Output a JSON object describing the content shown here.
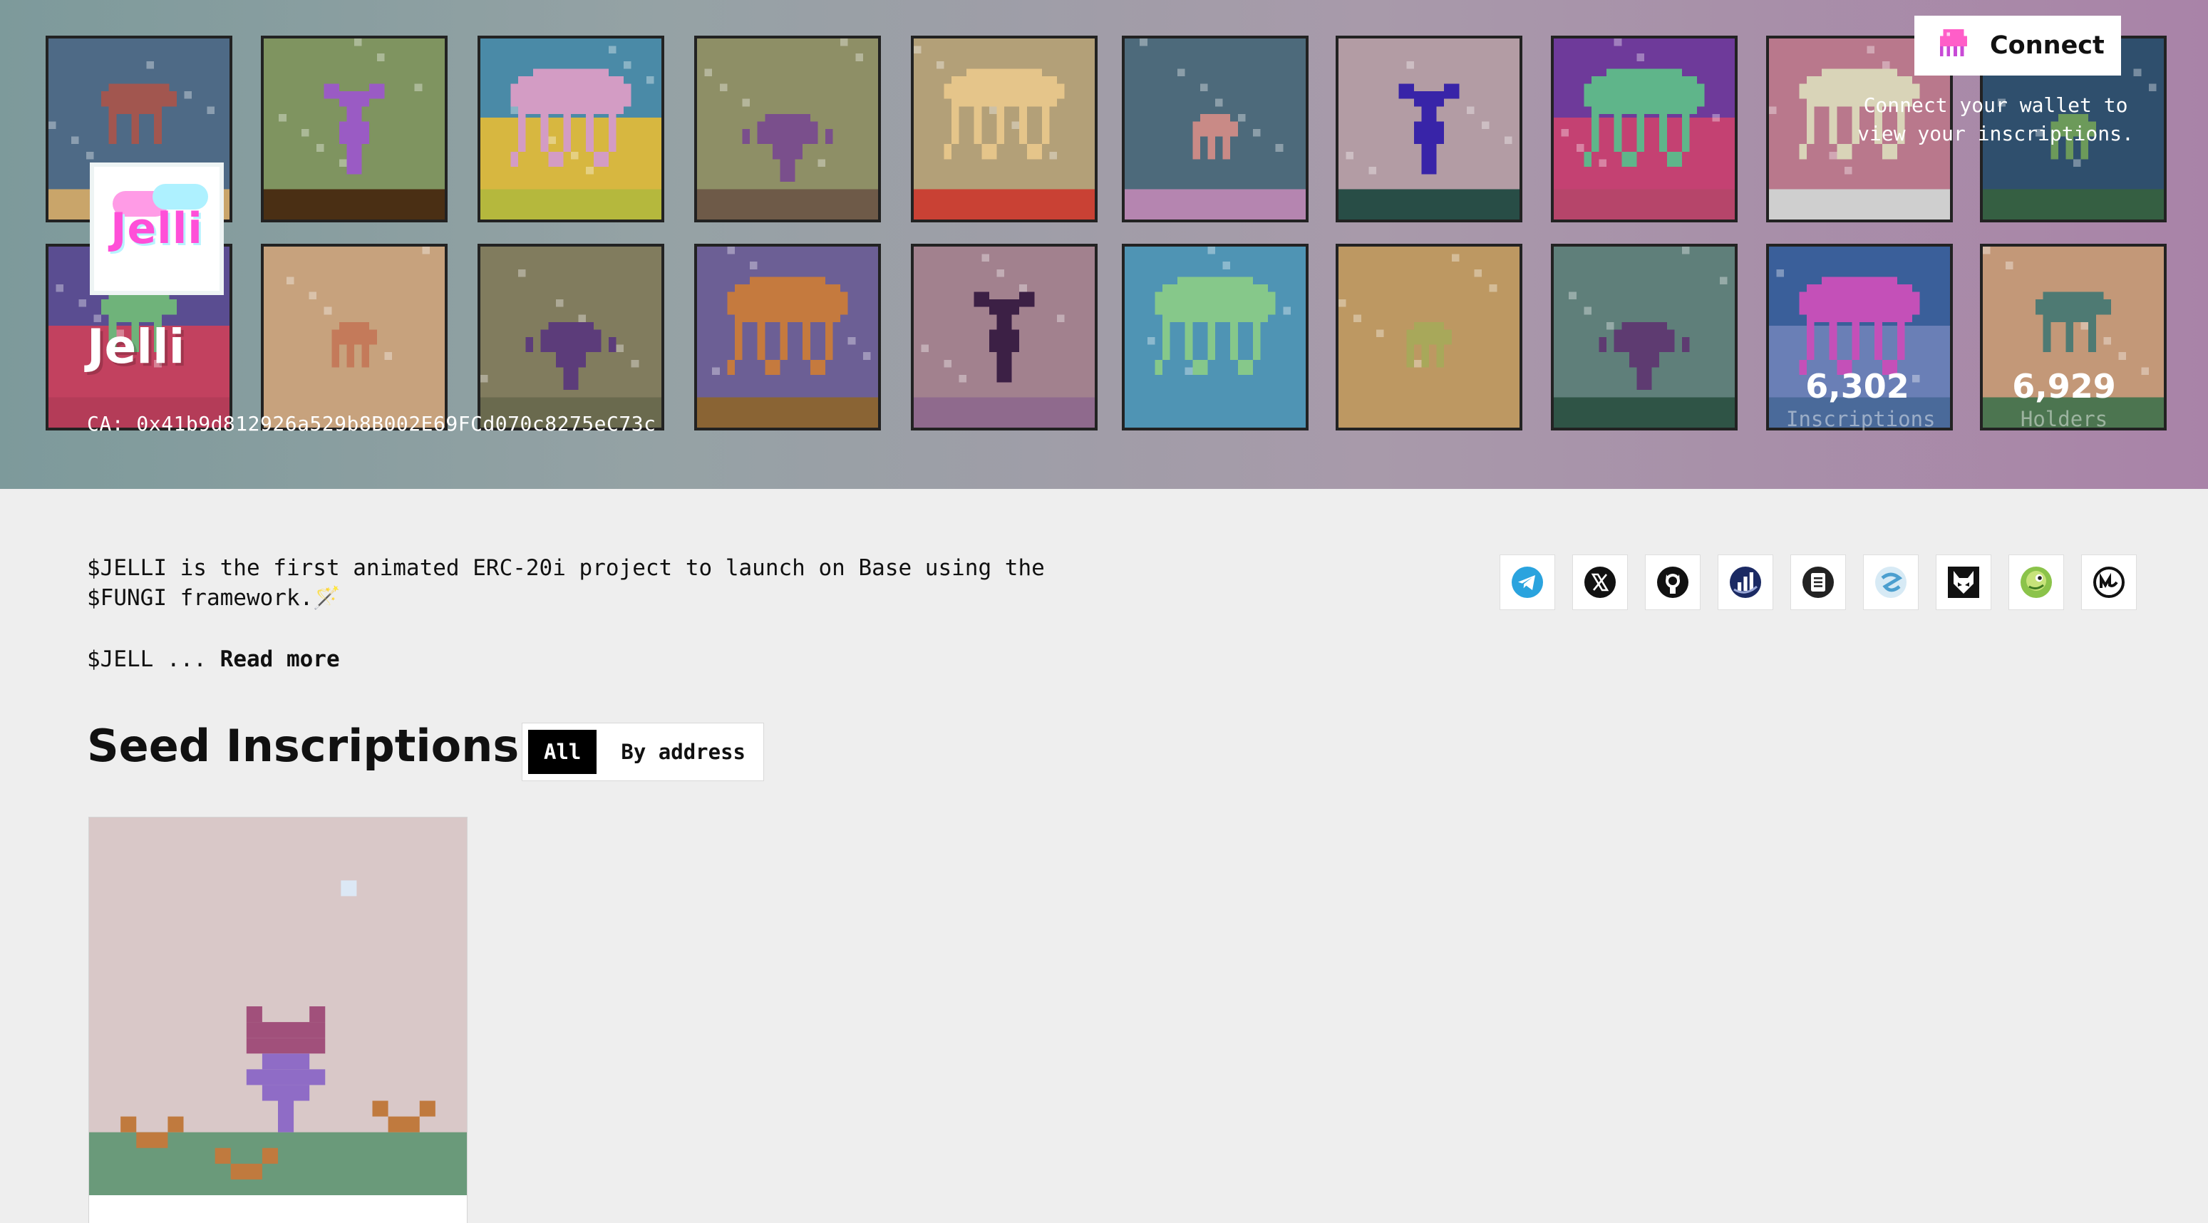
{
  "header": {
    "connect_label": "Connect",
    "connect_note": "Connect your wallet to view your inscriptions."
  },
  "project": {
    "logo_text": "Jelli",
    "name": "Jelli",
    "contract": "CA: 0x41b9d812926a529b8B002E69FCd070c8275eC73c",
    "stats": [
      {
        "value": "6,302",
        "label": "Inscriptions"
      },
      {
        "value": "6,929",
        "label": "Holders"
      }
    ]
  },
  "description": {
    "text": "$JELLI is the first animated ERC-20i project to launch on Base using the $FUNGI framework.🪄",
    "short": "$JELL ...",
    "read_more": "Read more"
  },
  "socials": [
    {
      "name": "telegram-icon",
      "color": "#2aa3de"
    },
    {
      "name": "x-icon",
      "color": "#111111"
    },
    {
      "name": "github-icon",
      "color": "#111111"
    },
    {
      "name": "chart-icon",
      "color": "#1b2a63"
    },
    {
      "name": "document-icon",
      "color": "#222222"
    },
    {
      "name": "dextools-icon",
      "color": "#5aa9d6"
    },
    {
      "name": "fox-icon",
      "color": "#111111"
    },
    {
      "name": "gecko-icon",
      "color": "#8bc34a"
    },
    {
      "name": "coinmarketcap-icon",
      "color": "#111111"
    }
  ],
  "section": {
    "title": "Seed Inscriptions",
    "filters": {
      "all": "All",
      "by_address": "By address"
    }
  },
  "tiles": [
    {
      "bg": "#4e6a86",
      "ground": "#c9a56a",
      "creature": "#a2564f",
      "type": "mushroom"
    },
    {
      "bg": "#7f9460",
      "ground": "#4a2f14",
      "creature": "#9a5bc4",
      "type": "plant"
    },
    {
      "bg": "#4a8aa7",
      "bg2": "#d7b740",
      "ground": "#b5b83d",
      "creature": "#d39cc4",
      "type": "jelly"
    },
    {
      "bg": "#8e8f66",
      "ground": "#6e5a48",
      "creature": "#7a4f8c",
      "type": "bulb"
    },
    {
      "bg": "#b3a078",
      "ground": "#c94134",
      "creature": "#e5c58a",
      "type": "jelly-thin"
    },
    {
      "bg": "#4d6a7b",
      "ground": "#b585b0",
      "creature": "#c98a86",
      "type": "mini"
    },
    {
      "bg": "#b39ca4",
      "ground": "#284d46",
      "creature": "#3824a8",
      "type": "plant"
    },
    {
      "bg": "#6e3a9a",
      "bg2": "#c44172",
      "ground": "#b6456a",
      "creature": "#5fb58a",
      "type": "jelly"
    },
    {
      "bg": "#b9788c",
      "ground": "#cfcfcf",
      "creature": "#d9d4b8",
      "type": "jelly-thin"
    },
    {
      "bg": "#2f4f6d",
      "ground": "#355f42",
      "creature": "#6c9a5a",
      "type": "mini"
    },
    {
      "bg": "#5a4d91",
      "bg2": "#c2415f",
      "ground": "#b43c58",
      "creature": "#6fb37a",
      "type": "mushroom"
    },
    {
      "bg": "#c7a27d",
      "ground": "#c7a27d",
      "creature": "#c47a5a",
      "type": "mini"
    },
    {
      "bg": "#817c5e",
      "ground": "#6a6a4e",
      "creature": "#5c3c7a",
      "type": "bulb"
    },
    {
      "bg": "#6c5f95",
      "ground": "#8a6434",
      "creature": "#c57a3e",
      "type": "jelly"
    },
    {
      "bg": "#a2818e",
      "ground": "#8f6a8d",
      "creature": "#3c2045",
      "type": "plant"
    },
    {
      "bg": "#4f94b4",
      "ground": "#4f94b4",
      "creature": "#86c88a",
      "type": "jelly"
    },
    {
      "bg": "#bd9862",
      "ground": "#bd9862",
      "creature": "#a8a85a",
      "type": "mini"
    },
    {
      "bg": "#5f7f7a",
      "ground": "#2f5446",
      "creature": "#5e3b71",
      "type": "bulb"
    },
    {
      "bg": "#3a5f9a",
      "bg2": "#6a7fb6",
      "ground": "#4a6a9a",
      "creature": "#c450b8",
      "type": "jelly"
    },
    {
      "bg": "#c39878",
      "ground": "#4c7550",
      "creature": "#4e7a73",
      "type": "mushroom"
    }
  ],
  "card": {
    "bg": "#d9c8c8",
    "ground": "#6a9a7a",
    "creature": "#8f6cc6",
    "cap": "#a1507b",
    "grass": "#c07a3e",
    "star": "#dce8f5"
  }
}
